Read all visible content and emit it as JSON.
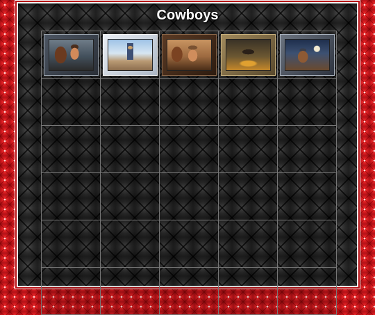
{
  "page": {
    "title": "Cowboys"
  },
  "gallery": {
    "columns": 5,
    "rows": 6,
    "thumbnails": [
      {
        "icon": "cowboy-with-horse-image"
      },
      {
        "icon": "child-cowboy-on-road-image"
      },
      {
        "icon": "shirtless-cowboy-with-horse-image"
      },
      {
        "icon": "cowboy-hat-campfire-image"
      },
      {
        "icon": "cowboy-at-night-image"
      }
    ]
  },
  "colors": {
    "background_red": "#c8161c",
    "panel_dark": "#1e1e1e",
    "frame_white": "#f3f3f3",
    "grid_line": "#777777",
    "title_text": "#ffffff"
  }
}
